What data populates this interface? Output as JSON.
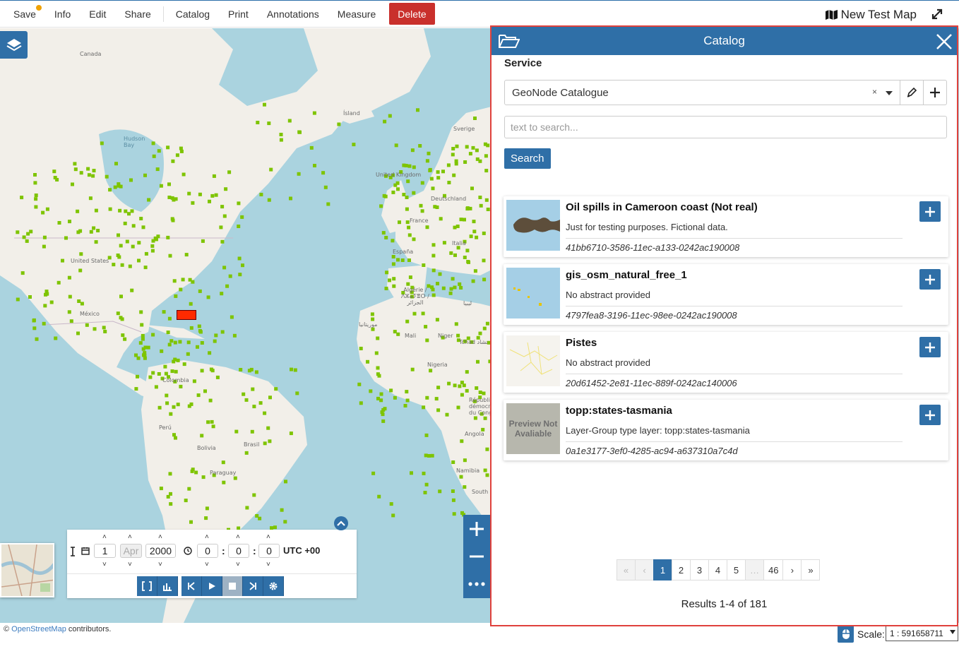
{
  "menu": {
    "items": [
      "Save",
      "Info",
      "Edit",
      "Share",
      "Catalog",
      "Print",
      "Annotations",
      "Measure"
    ],
    "delete_label": "Delete"
  },
  "map_title": "New Test Map",
  "map_labels": {
    "canada": "Canada",
    "hudson": "Hudson\nBay",
    "island": "Ísland",
    "sverige": "Sverige",
    "uk": "United Kingdom",
    "deutschland": "Deutschland",
    "france": "France",
    "espana": "España",
    "italia": "Italia",
    "us": "United States",
    "mexico": "México",
    "algerie": "Algérie /\nⴷⵣⴰⵢⴻⵔ /\nالجزائر",
    "libya": "ليبيا",
    "mauritanie": "موريتانيا",
    "mali": "Mali",
    "niger": "Niger",
    "tchad": "Tchad تشاد",
    "nigeria": "Nigeria",
    "colombia": "Colombia",
    "peru": "Perú",
    "brasil": "Brasil",
    "bolivia": "Bolivia",
    "paraguay": "Paraguay",
    "angola": "Angola",
    "rdc": "République\ndémocratique\ndu Congo",
    "namibia": "Namibia",
    "south": "South"
  },
  "catalog": {
    "title": "Catalog",
    "service_label": "Service",
    "service_value": "GeoNode Catalogue",
    "search_placeholder": "text to search...",
    "search_button": "Search",
    "records": [
      {
        "title": "Oil spills in Cameroon coast (Not real)",
        "description": "Just for testing purposes. Fictional data.",
        "id": "41bb6710-3586-11ec-a133-0242ac190008",
        "thumb": "oil"
      },
      {
        "title": "gis_osm_natural_free_1",
        "description": "No abstract provided",
        "id": "4797fea8-3196-11ec-98ee-0242ac190008",
        "thumb": "natural"
      },
      {
        "title": "Pistes",
        "description": "No abstract provided",
        "id": "20d61452-2e81-11ec-889f-0242ac140006",
        "thumb": "pistes"
      },
      {
        "title": "topp:states-tasmania",
        "description": "Layer-Group type layer: topp:states-tasmania",
        "id": "0a1e3177-3ef0-4285-ac94-a637310a7c4d",
        "thumb": "preview",
        "thumb_text": "Preview Not Avaliable"
      }
    ],
    "pagination": [
      "«",
      "‹",
      "1",
      "2",
      "3",
      "4",
      "5",
      "…",
      "46",
      "›",
      "»"
    ],
    "current_page": "1",
    "results": "Results 1-4 of 181"
  },
  "timeline": {
    "day": "1",
    "month": "Apr",
    "year": "2000",
    "hour": "0",
    "minute": "0",
    "second": "0",
    "utc": "UTC +00"
  },
  "footer": {
    "attribution_prefix": "©",
    "attribution_link": "OpenStreetMap",
    "attribution_suffix": "contributors.",
    "scale_label": "Scale:",
    "scale_value": "1 : 591658711"
  },
  "colors": {
    "primary": "#2f6fa7",
    "delete": "#c9302c",
    "ocean": "#aad3df",
    "land": "#f2efe9",
    "points": "#7ec400",
    "highlight_border": "#e0413c"
  }
}
